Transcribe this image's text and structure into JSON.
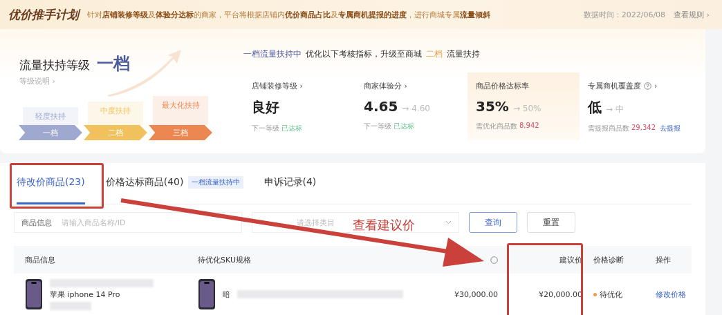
{
  "banner": {
    "title": "优价推手计划",
    "description": "针对**店铺装修等级**及**体验分达标**的商家，平台将根据店铺内**优价商品占比**及**专属商机提报的进度**，进行商城专属**流量倾斜**",
    "date": "数据时间：2022/06/08",
    "rules_link": "查看规则 ›"
  },
  "level": {
    "title": "流量扶持等级",
    "current": "一档",
    "explain_link": "等级说明 ›",
    "steps": [
      {
        "support": "轻度扶持",
        "tier": "一档",
        "color": "#9fa9cf"
      },
      {
        "support": "中度扶持",
        "tier": "二档",
        "color": "#f0c15c"
      },
      {
        "support": "最大化扶持",
        "tier": "三档",
        "color": "#ec8752"
      }
    ]
  },
  "goal": {
    "status": "一档流量扶持中",
    "text": "优化以下考核指标，升级至商城",
    "target": "二档",
    "suffix": "流量扶持"
  },
  "metrics": [
    {
      "title": "店铺装修等级 ›",
      "value": "良好",
      "sub": "下一等级",
      "sub_value": "已达标",
      "achieved": true,
      "highlighted": false
    },
    {
      "title": "商家体验分 ›",
      "value": "4.65",
      "target": "→ 4.60",
      "sub": "下一等级",
      "sub_value": "已达标",
      "achieved": true,
      "highlighted": false
    },
    {
      "title": "商品价格达标率",
      "value": "35%",
      "target": "→ 50%",
      "sub": "需优化商品数",
      "sub_value": "8,942",
      "achieved": false,
      "highlighted": true
    },
    {
      "title": "专属商机覆盖度",
      "help": true,
      "chevron": "›",
      "value": "低",
      "target": "→ 中",
      "sub": "需提报商品数",
      "sub_value": "29,342",
      "achieved": false,
      "link": "去提报",
      "highlighted": false
    }
  ],
  "tabs": [
    {
      "label": "待改价商品(23)",
      "selected": true
    },
    {
      "label": "价格达标商品(40)",
      "badge": "一档流量扶持中",
      "selected": false
    },
    {
      "label": "申诉记录(4)",
      "selected": false
    }
  ],
  "filters": [
    {
      "kind": "input",
      "label": "商品信息",
      "placeholder": "请输入商品名称/ID"
    },
    {
      "kind": "select",
      "placeholder": "请选择类目"
    }
  ],
  "buttons": [
    {
      "label": "查询",
      "primary": true
    },
    {
      "label": "重置",
      "primary": false
    }
  ],
  "table": {
    "columns": [
      "商品信息",
      "待优化SKU规格",
      "",
      "建议价",
      "价格诊断",
      "操作"
    ],
    "rows": [
      {
        "product": "苹果 iphone 14 Pro",
        "sku": "暗",
        "price": "¥30,000.00",
        "suggested": "¥20,000.00",
        "status": "待优化",
        "color": "#f0a040",
        "action": "修改价格"
      }
    ]
  },
  "annotation": {
    "text": "查看建议价"
  }
}
